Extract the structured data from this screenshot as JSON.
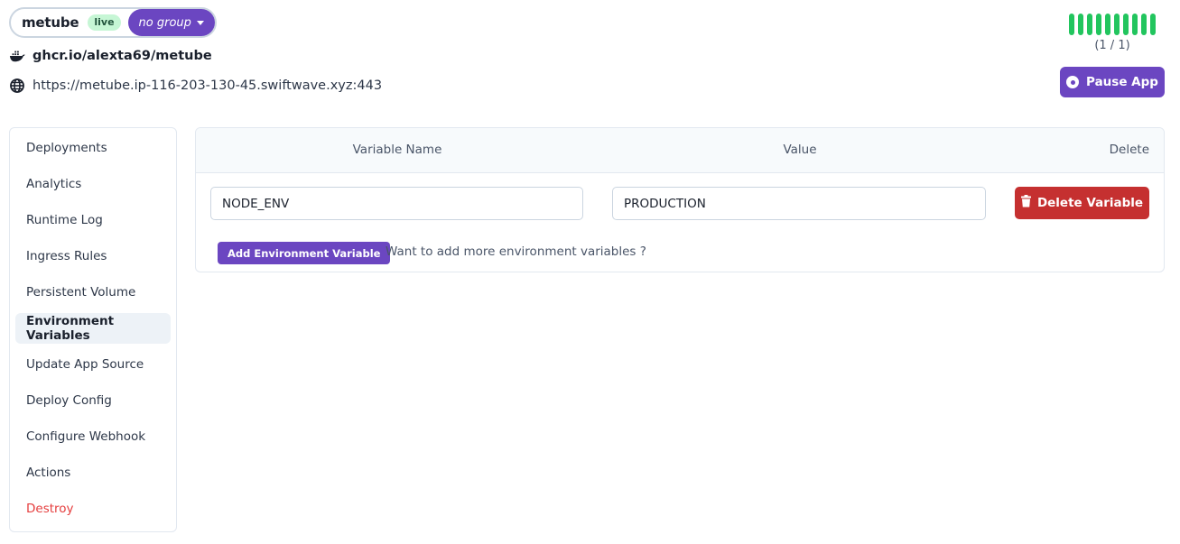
{
  "app": {
    "name": "metube",
    "status_badge": "live",
    "group_label": "no group",
    "image": "ghcr.io/alexta69/metube",
    "url": "https://metube.ip-116-203-130-45.swiftwave.xyz:443"
  },
  "replicas": {
    "bar_count": 10,
    "bar_color": "#22c55e",
    "label": "(1 / 1)"
  },
  "actions": {
    "pause_label": "Pause App"
  },
  "sidebar": {
    "items": [
      {
        "label": "Deployments",
        "active": false,
        "danger": false
      },
      {
        "label": "Analytics",
        "active": false,
        "danger": false
      },
      {
        "label": "Runtime Log",
        "active": false,
        "danger": false
      },
      {
        "label": "Ingress Rules",
        "active": false,
        "danger": false
      },
      {
        "label": "Persistent Volume",
        "active": false,
        "danger": false
      },
      {
        "label": "Environment Variables",
        "active": true,
        "danger": false
      },
      {
        "label": "Update App Source",
        "active": false,
        "danger": false
      },
      {
        "label": "Deploy Config",
        "active": false,
        "danger": false
      },
      {
        "label": "Configure Webhook",
        "active": false,
        "danger": false
      },
      {
        "label": "Actions",
        "active": false,
        "danger": false
      },
      {
        "label": "Destroy",
        "active": false,
        "danger": true
      }
    ]
  },
  "env_table": {
    "headers": {
      "name": "Variable Name",
      "value": "Value",
      "delete": "Delete"
    },
    "rows": [
      {
        "name": "NODE_ENV",
        "value": "PRODUCTION",
        "delete_label": "Delete Variable"
      }
    ],
    "add_button_label": "Add Environment Variable",
    "add_hint": "Want to add more environment variables ?"
  },
  "colors": {
    "accent": "#6b46c1",
    "danger": "#c53030",
    "live_bg": "#c6f6d5",
    "destroy_text": "#e53e3e"
  }
}
